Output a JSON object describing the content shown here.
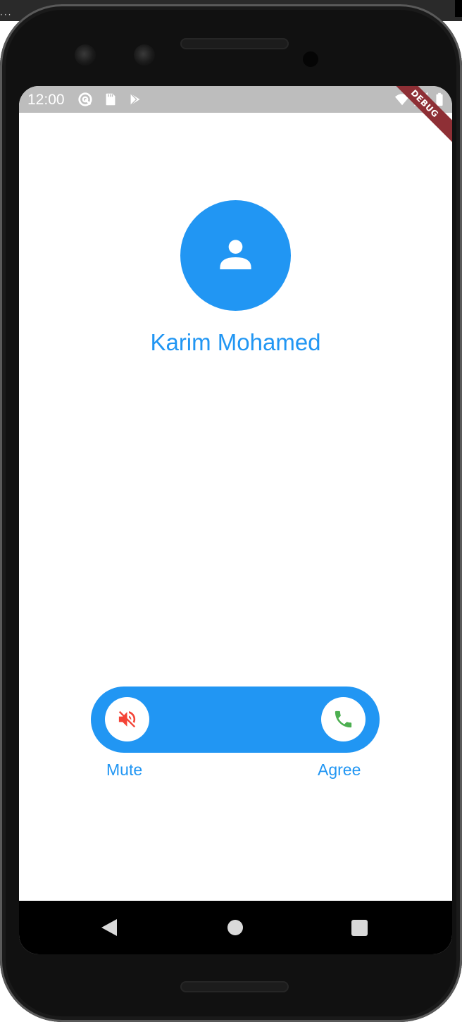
{
  "status_bar": {
    "time": "12:00",
    "icons": [
      "sync-icon",
      "sd-card-icon",
      "play-store-icon",
      "wifi-icon",
      "signal-icon",
      "battery-icon"
    ],
    "debug_banner": "DEBUG"
  },
  "caller": {
    "name": "Karim Mohamed",
    "avatar_icon": "person-icon"
  },
  "call_controls": {
    "mute_label": "Mute",
    "mute_icon": "volume-off-icon",
    "agree_label": "Agree",
    "agree_icon": "phone-icon"
  },
  "nav_bar": {
    "icons": [
      "back-icon",
      "home-icon",
      "recents-icon"
    ]
  },
  "colors": {
    "accent": "#2196f3",
    "mute": "#f44336",
    "agree": "#4caf50",
    "status_bar": "#bdbdbd",
    "debug_banner": "#8e2f35"
  }
}
